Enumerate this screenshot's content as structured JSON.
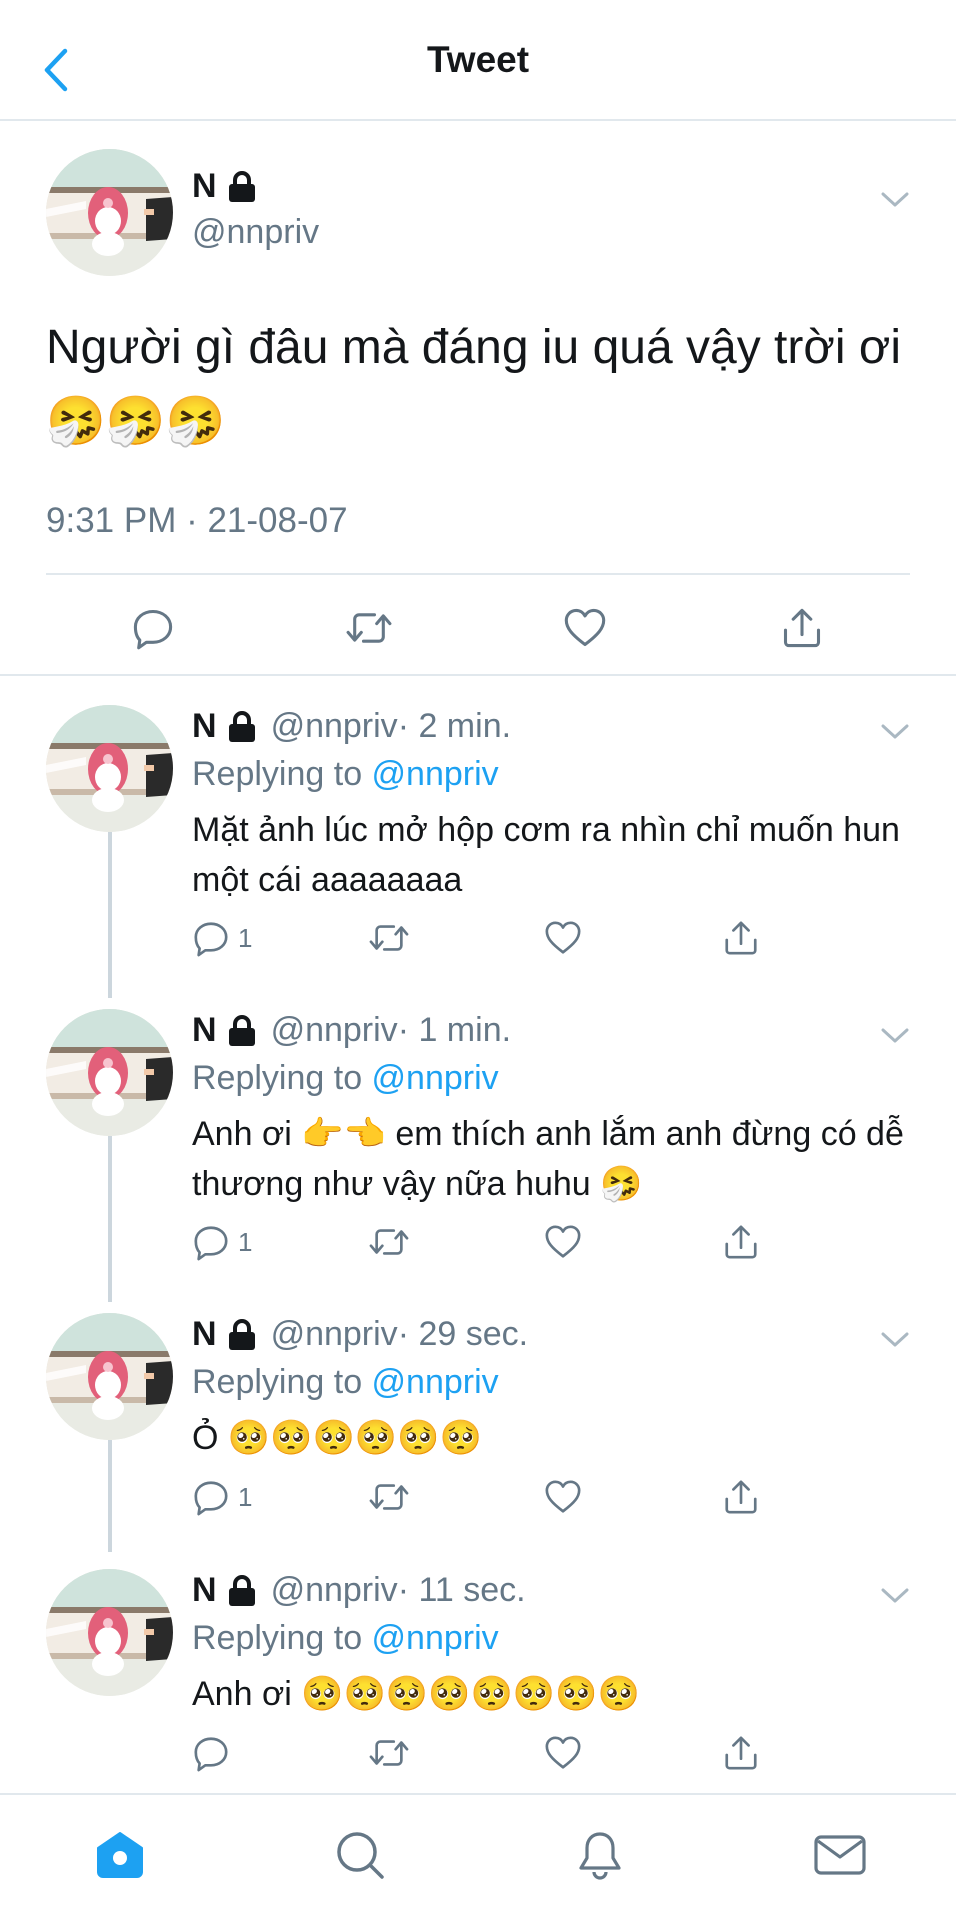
{
  "header": {
    "title": "Tweet",
    "back_icon": "chevron-left-icon",
    "accent": "#1da1f2"
  },
  "main_tweet": {
    "name": "N",
    "handle": "@nnpriv",
    "text": "Người gì đâu mà đáng iu quá vậy trời ơi 🤧🤧🤧",
    "timestamp": "9:31 PM · 21-08-07"
  },
  "replies": [
    {
      "name": "N",
      "handle": "@nnpriv",
      "time": "· 2 min.",
      "replying_prefix": "Replying to ",
      "replying_to": "@nnpriv",
      "text": "Mặt ảnh lúc mở hộp cơm ra nhìn chỉ muốn hun một cái aaaaaaaa",
      "reply_count": "1"
    },
    {
      "name": "N",
      "handle": "@nnpriv",
      "time": "· 1 min.",
      "replying_prefix": "Replying to ",
      "replying_to": "@nnpriv",
      "text": "Anh ơi 👉👈 em thích anh lắm anh đừng có dễ thương như vậy nữa huhu 🤧",
      "reply_count": "1"
    },
    {
      "name": "N",
      "handle": "@nnpriv",
      "time": "· 29 sec.",
      "replying_prefix": "Replying to ",
      "replying_to": "@nnpriv",
      "text": "Ỏ 🥺🥺🥺🥺🥺🥺",
      "reply_count": "1"
    },
    {
      "name": "N",
      "handle": "@nnpriv",
      "time": "· 11 sec.",
      "replying_prefix": "Replying to ",
      "replying_to": "@nnpriv",
      "text": "Anh ơi 🥺🥺🥺🥺🥺🥺🥺🥺",
      "reply_count": ""
    }
  ],
  "tabbar": {
    "items": [
      "home-icon",
      "search-icon",
      "notifications-icon",
      "messages-icon"
    ],
    "active": "home-icon"
  }
}
